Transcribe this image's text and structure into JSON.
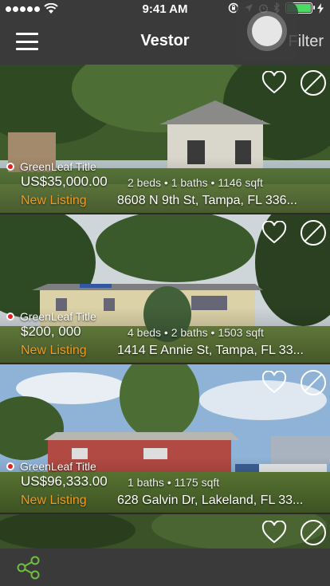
{
  "status_bar": {
    "time": "9:41 AM"
  },
  "nav": {
    "title": "Vestor",
    "filter_label": "Filter"
  },
  "listings": [
    {
      "agency": "GreenLeaf Title",
      "price": "US$35,000.00",
      "specs": "2 beds • 1 baths • 1146 sqft",
      "status": "New Listing",
      "address": "8608 N 9th St, Tampa, FL 336..."
    },
    {
      "agency": "GreenLeaf Title",
      "price": "$200, 000",
      "specs": "4 beds • 2 baths • 1503 sqft",
      "status": "New Listing",
      "address": "1414 E Annie St, Tampa, FL 33..."
    },
    {
      "agency": "GreenLeaf Title",
      "price": "US$96,333.00",
      "specs": "1 baths • 1175 sqft",
      "status": "New Listing",
      "address": "628 Galvin Dr, Lakeland, FL 33..."
    }
  ],
  "colors": {
    "accent_green": "#4cd964",
    "status_orange": "#f29a1e",
    "marker_red": "#e02020",
    "bar_bg": "#3a3a3a"
  },
  "icons": {
    "menu": "hamburger-icon",
    "favorite": "heart-icon",
    "hide": "block-icon",
    "share": "share-icon"
  }
}
